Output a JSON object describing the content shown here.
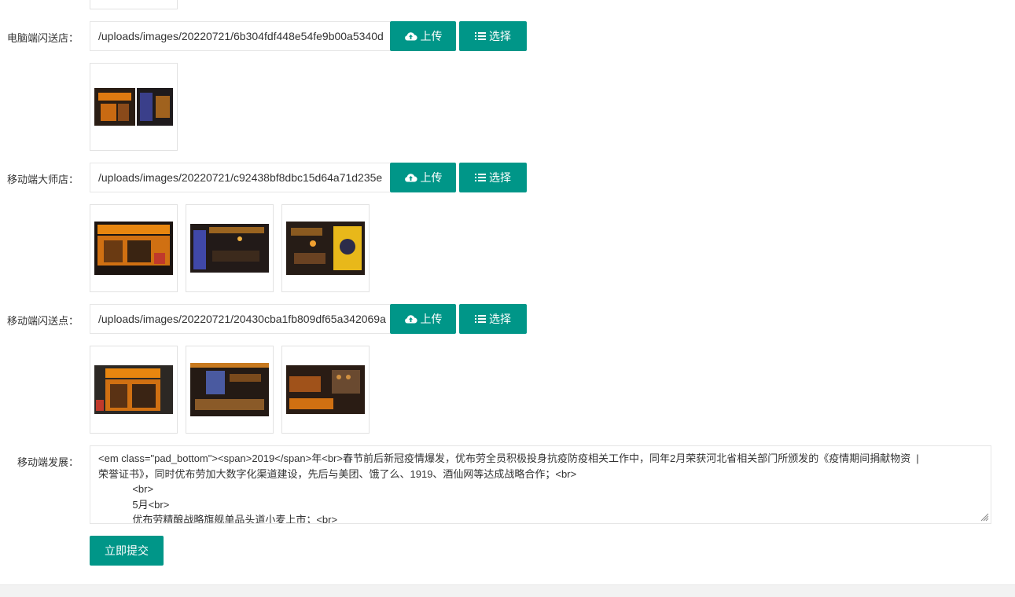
{
  "rows": [
    {
      "label": "电脑端闪送店：",
      "path": "/uploads/images/20220721/6b304fdf448e54fe9b00a5340d",
      "upload_label": "上传",
      "select_label": "选择"
    },
    {
      "label": "移动端大师店：",
      "path": "/uploads/images/20220721/c92438bf8dbc15d64a71d235e",
      "upload_label": "上传",
      "select_label": "选择"
    },
    {
      "label": "移动端闪送点：",
      "path": "/uploads/images/20220721/20430cba1fb809df65a342069a",
      "upload_label": "上传",
      "select_label": "选择"
    }
  ],
  "development": {
    "label": "移动端发展：",
    "lines": [
      "<em class=\"pad_bottom\"><span>2019</span>年<br>春节前后新冠疫情爆发，优布劳全员积极投身抗疫防疫相关工作中，同年2月荣获河北省相关部门所颁发的《疫情期间捐献物资  |",
      "荣誉证书》，同时优布劳加大数字化渠道建设，先后与美团、饿了么、1919、酒仙网等达成战略合作；<br>",
      "            <br>",
      "            5月<br>",
      "            优布劳精酿战略旗舰单品头道小麦上市；<br>"
    ]
  },
  "submit_label": "立即提交",
  "icons": {
    "upload": "cloud-upload-icon",
    "select": "list-icon"
  },
  "colors": {
    "accent": "#009688",
    "border": "#e6e6e6",
    "text": "#333333"
  }
}
